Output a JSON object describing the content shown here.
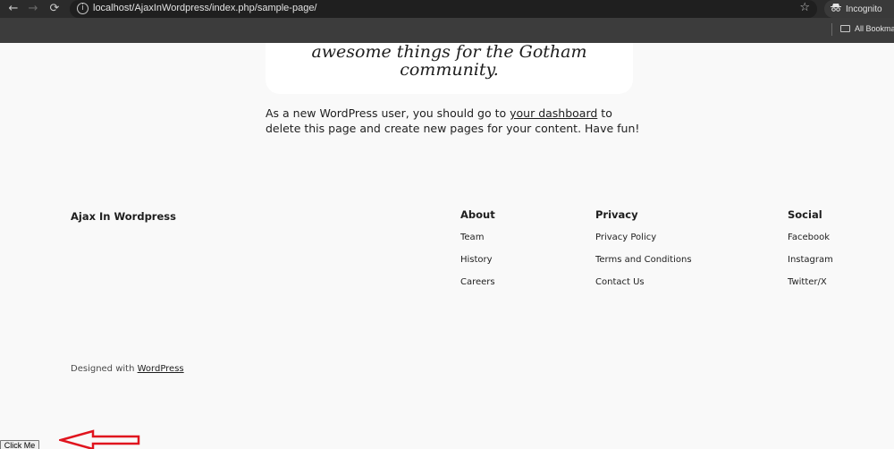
{
  "browser": {
    "url": "localhost/AjaxInWordpress/index.php/sample-page/",
    "incognito_label": "Incognito",
    "bookmarks_label": "All Bookmarks",
    "nav_back": "←",
    "nav_forward": "→",
    "nav_reload": "⟳",
    "star": "☆",
    "site_info": "i"
  },
  "content": {
    "quote": "awesome things for the Gotham community.",
    "intro_before": "As a new WordPress user, you should go to ",
    "intro_link": "your dashboard",
    "intro_after": " to delete this page and create new pages for your content. Have fun!"
  },
  "footer": {
    "site_title": "Ajax In Wordpress",
    "columns": [
      {
        "heading": "About",
        "links": [
          "Team",
          "History",
          "Careers"
        ]
      },
      {
        "heading": "Privacy",
        "links": [
          "Privacy Policy",
          "Terms and Conditions",
          "Contact Us"
        ]
      },
      {
        "heading": "Social",
        "links": [
          "Facebook",
          "Instagram",
          "Twitter/X"
        ]
      }
    ],
    "credit_prefix": "Designed with ",
    "credit_link": "WordPress"
  },
  "button": {
    "label": "Click Me"
  },
  "colors": {
    "annotation_arrow": "#e0141e",
    "chrome_bg": "#3c3c3c",
    "page_bg": "#f9f9f9"
  }
}
